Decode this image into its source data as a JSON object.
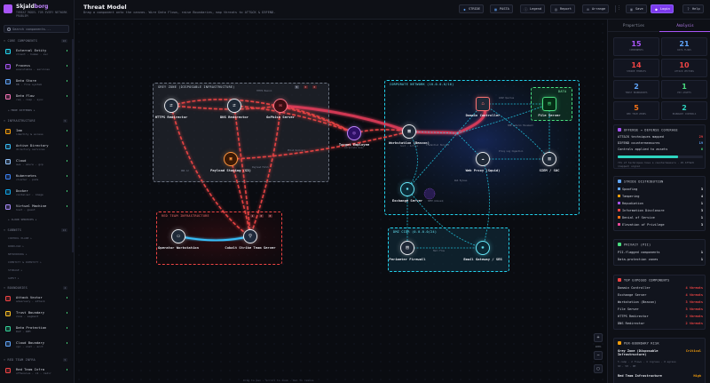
{
  "app": {
    "name_main": "Skjald",
    "name_accent": "borg",
    "subtitle": "THREAT MODEL FOR EVERY NETWORK PROBLEM"
  },
  "header": {
    "title": "Threat Model",
    "subtitle": "Drag a component onto the canvas. Wire Data Flows, raise Boundaries, map threats to ATT&CK & D3FEND.",
    "buttons": {
      "stride": "STRIDE",
      "pasta": "PASTA",
      "legend": "Legend",
      "report": "Report",
      "arrange": "Arrange",
      "more": "⋮",
      "save": "Save",
      "login": "Login",
      "help": "Help"
    }
  },
  "sidebar": {
    "search_placeholder": "Search components...",
    "sections": [
      {
        "title": "CORE COMPONENTS",
        "count": "10"
      },
      {
        "title": "INFRASTRUCTURE",
        "count": "5"
      },
      {
        "title": "SUBNETS",
        "count": "12"
      },
      {
        "title": "BOUNDARIES",
        "count": "4"
      },
      {
        "title": "RED TEAM INFRA",
        "count": "5"
      }
    ],
    "items": [
      {
        "name": "External Entity",
        "desc": "client · human · svc",
        "color": "#22d3ee"
      },
      {
        "name": "Process",
        "desc": "executable · services",
        "color": "#a855f7"
      },
      {
        "name": "Data Store",
        "desc": "DB · file system",
        "color": "#60a5fa"
      },
      {
        "name": "Data Flow",
        "desc": "req · resp · sync",
        "color": "#f472b6"
      },
      {
        "name": "Iam",
        "desc": "identity & access",
        "color": "#f59e0b"
      },
      {
        "name": "Active Directory",
        "desc": "directory services",
        "color": "#38bdf8"
      },
      {
        "name": "Cloud",
        "desc": "aws · azure · gcp",
        "color": "#93c5fd"
      },
      {
        "name": "Kubernetes",
        "desc": "cluster · pods",
        "color": "#3b82f6"
      },
      {
        "name": "Docker",
        "desc": "container · image",
        "color": "#0ea5e9"
      },
      {
        "name": "Virtual Machine",
        "desc": "host · guest",
        "color": "#a78bfa"
      },
      {
        "name": "Attack Vector",
        "desc": "adversary · attack",
        "color": "#ef4444"
      },
      {
        "name": "Trust Boundary",
        "desc": "zone · segment",
        "color": "#fbbf24"
      },
      {
        "name": "Data Protection",
        "desc": "DLP · DPM",
        "color": "#34d399"
      },
      {
        "name": "Cloud Boundary",
        "desc": "vpc · vnet · acct",
        "color": "#60a5fa"
      },
      {
        "name": "Red Team Infra",
        "desc": "offensive · c2 · redir",
        "color": "#ef4444"
      }
    ],
    "links": {
      "more_patterns": "+ MORE PATTERNS ▸",
      "cloud_services": "+ CLOUD SERVICES ▸"
    },
    "subnets": [
      "CONTROL PLANE ▸",
      "WORKLOAD ▸",
      "NETWORKING ▸",
      "IDENTITY & IDENTITY ▸",
      "STORAGE ▸",
      "GUEST ▸"
    ]
  },
  "canvas": {
    "zones": [
      {
        "label": "GREY ZONE (DISPOSABLE INFRASTRUCTURE)",
        "stats": [
          "5",
          "0",
          "0"
        ],
        "color": "#9ca3af"
      },
      {
        "label": "RED TEAM INFRASTRUCTURE",
        "stats": [
          "2",
          "0",
          "0"
        ],
        "color": "#ef4444"
      },
      {
        "label": "CORPORATE NETWORK (10.0.0.0/16)",
        "stats": [
          "5",
          "2",
          "0"
        ],
        "color": "#22d3ee"
      },
      {
        "label": "DMZ CIDR (0.0.0.0/24)",
        "stats": [
          "2",
          "0",
          "0"
        ],
        "color": "#22d3ee"
      },
      {
        "label": "DATA",
        "stats": [
          "1",
          "0"
        ],
        "color": "#4ade80"
      }
    ],
    "nodes": [
      {
        "label": "HTTPS Redirector",
        "sub": "",
        "icon": "redirect-icon",
        "glyph": "⇄"
      },
      {
        "label": "DNS Redirector",
        "sub": "",
        "icon": "redirect-icon",
        "glyph": "⇄"
      },
      {
        "label": "GoPhish Server",
        "sub": "",
        "icon": "phishing-icon",
        "glyph": "✉"
      },
      {
        "label": "Target Employee",
        "sub": "Corporate User",
        "icon": "globe-icon",
        "glyph": "◎"
      },
      {
        "label": "Payload Staging (S3)",
        "sub": "",
        "icon": "package-icon",
        "glyph": "▣"
      },
      {
        "label": "Operator Workstation",
        "sub": "",
        "icon": "monitor-icon",
        "glyph": "▭"
      },
      {
        "label": "Cobalt Strike Team Server",
        "sub": "",
        "icon": "server-icon",
        "glyph": "⚲"
      },
      {
        "label": "Domain Controller",
        "sub": "",
        "icon": "lock-icon",
        "glyph": "⌂"
      },
      {
        "label": "File Server",
        "sub": "",
        "icon": "storage-icon",
        "glyph": "▤"
      },
      {
        "label": "Workstation (Beacon)",
        "sub": "host · Active",
        "icon": "computer-icon",
        "glyph": "▦"
      },
      {
        "label": "Web Proxy (Squid)",
        "sub": "",
        "icon": "cloud-icon",
        "glyph": "☁"
      },
      {
        "label": "SIEM / SOC",
        "sub": "",
        "icon": "shield-icon",
        "glyph": "▥"
      },
      {
        "label": "Exchange Server",
        "sub": "",
        "icon": "exchange-icon",
        "glyph": "✹"
      },
      {
        "label": "Perimeter Firewall",
        "sub": "",
        "icon": "firewall-icon",
        "glyph": "▤"
      },
      {
        "label": "Email Gateway / SEG",
        "sub": "",
        "icon": "gateway-icon",
        "glyph": "✺"
      }
    ],
    "edge_tags": [
      "HTTPS Beacon",
      "DNS C2",
      "Phish Delivery",
      "Payload Fetch",
      "Credential Harvest",
      "LDAP Queries",
      "SMB Lateral Movement",
      "Proxy Log Ingestion",
      "Web Egress",
      "SMTP Inbound",
      "Mail Flow"
    ],
    "zoom": "100%",
    "footer_hint": "Drag to pan · Scroll to zoom · Del to remove"
  },
  "right_panel": {
    "tabs": [
      "Properties",
      "Analysis"
    ],
    "stats": [
      {
        "value": "15",
        "label": "COMPONENTS",
        "color": "#a855f7"
      },
      {
        "value": "21",
        "label": "DATA FLOWS",
        "color": "#60a5fa"
      },
      {
        "value": "14",
        "label": "STRIDE THREATS",
        "color": "#ef4444"
      },
      {
        "value": "10",
        "label": "ATTACK VECTORS",
        "color": "#ef4444"
      },
      {
        "value": "2",
        "label": "TRUST BOUNDARIES",
        "color": "#60a5fa"
      },
      {
        "value": "1",
        "label": "PII ASSETS",
        "color": "#4ade80"
      },
      {
        "value": "5",
        "label": "RED TEAM ZONES",
        "color": "#f97316"
      },
      {
        "value": "2",
        "label": "BOUNDARY CONTROLS",
        "color": "#2dd4bf"
      }
    ],
    "coverage": {
      "title": "OFFENSE ↔ DEFENSE COVERAGE",
      "rows": [
        {
          "label": "ATT&CK techniques mapped",
          "value": "29",
          "color": "#ef4444"
        },
        {
          "label": "D3FEND countermeasures",
          "value": "19",
          "color": "#60a5fa"
        },
        {
          "label": "Controls applied to assets",
          "value": "6",
          "color": "#4ade80"
        }
      ],
      "progress": 0.71,
      "caption": "71% of techniques have a countermeasure · 29 ATT&CK (mapped) signal"
    },
    "stride": {
      "title": "STRIDE DISTRIBUTION",
      "rows": [
        {
          "label": "Spoofing",
          "value": "3",
          "color": "#60a5fa"
        },
        {
          "label": "Tampering",
          "value": "4",
          "color": "#f59e0b"
        },
        {
          "label": "Repudiation",
          "value": "1",
          "color": "#a855f7"
        },
        {
          "label": "Information Disclosure",
          "value": "3",
          "color": "#ef4444"
        },
        {
          "label": "Denial of Service",
          "value": "1",
          "color": "#f97316"
        },
        {
          "label": "Elevation of Privilege",
          "value": "3",
          "color": "#ec4899"
        }
      ]
    },
    "privacy": {
      "title": "PRIVACY (PII)",
      "rows": [
        {
          "label": "PII-flagged components",
          "value": "1"
        },
        {
          "label": "Data-protection zones",
          "value": "1"
        }
      ]
    },
    "exposed": {
      "title": "TOP EXPOSED COMPONENTS",
      "rows": [
        {
          "label": "Domain Controller",
          "value": "4 threats"
        },
        {
          "label": "Exchange Server",
          "value": "4 threats"
        },
        {
          "label": "Workstation (Beacon)",
          "value": "3 threats"
        },
        {
          "label": "File Server",
          "value": "3 threats"
        },
        {
          "label": "HTTPS Redirector",
          "value": "2 threats"
        },
        {
          "label": "DNS Redirector",
          "value": "2 threats"
        }
      ]
    },
    "boundary_risk": {
      "title": "PER-BOUNDARY RISK",
      "entries": [
        {
          "name": "Grey Zone (Disposable Infrastructure)",
          "level": "Critical",
          "meta": "5 comp · 2 flows · 4 ingress · 0 egress",
          "meta_b": "SH · 5H · 0M"
        },
        {
          "name": "Red Team Infrastructure",
          "level": "High",
          "meta": "",
          "meta_b": ""
        }
      ]
    }
  },
  "colors": {
    "accent": "#a855f7",
    "attack_flow": "#ef4444",
    "network_flow": "#22d3ee",
    "canvas_bg": "#0a0c11"
  }
}
